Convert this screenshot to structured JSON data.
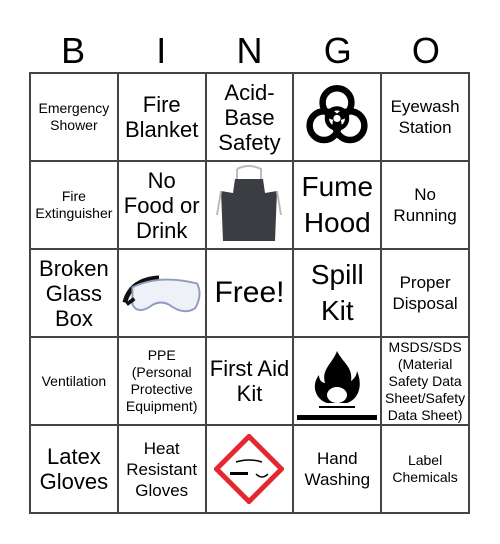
{
  "header": [
    "B",
    "I",
    "N",
    "G",
    "O"
  ],
  "cells": [
    {
      "text": "Emergency Shower",
      "size": "s"
    },
    {
      "text": "Fire Blanket",
      "size": "l"
    },
    {
      "text": "Acid-Base Safety",
      "size": "l"
    },
    {
      "icon": "biohazard-icon"
    },
    {
      "text": "Eyewash Station",
      "size": "m"
    },
    {
      "text": "Fire Extinguisher",
      "size": "s"
    },
    {
      "text": "No Food or Drink",
      "size": "l"
    },
    {
      "icon": "apron-icon"
    },
    {
      "text": "Fume Hood",
      "size": "xxl"
    },
    {
      "text": "No Running",
      "size": "m"
    },
    {
      "text": "Broken Glass Box",
      "size": "l"
    },
    {
      "icon": "goggles-icon"
    },
    {
      "text": "Free!",
      "size": "xl"
    },
    {
      "text": "Spill Kit",
      "size": "xxl"
    },
    {
      "text": "Proper Disposal",
      "size": "m"
    },
    {
      "text": "Ventilation",
      "size": "s"
    },
    {
      "text": "PPE (Personal Protective Equipment)",
      "size": "s"
    },
    {
      "text": "First Aid Kit",
      "size": "l"
    },
    {
      "icon": "flammable-icon"
    },
    {
      "text": "MSDS/SDS (Material Safety Data Sheet/Safety Data Sheet)",
      "size": "s"
    },
    {
      "text": "Latex Gloves",
      "size": "l"
    },
    {
      "text": "Heat Resistant Gloves",
      "size": "m"
    },
    {
      "icon": "corrosive-icon"
    },
    {
      "text": "Hand Washing",
      "size": "m"
    },
    {
      "text": "Label Chemicals",
      "size": "s"
    }
  ],
  "colors": {
    "corrosive_border": "#e3292f"
  }
}
